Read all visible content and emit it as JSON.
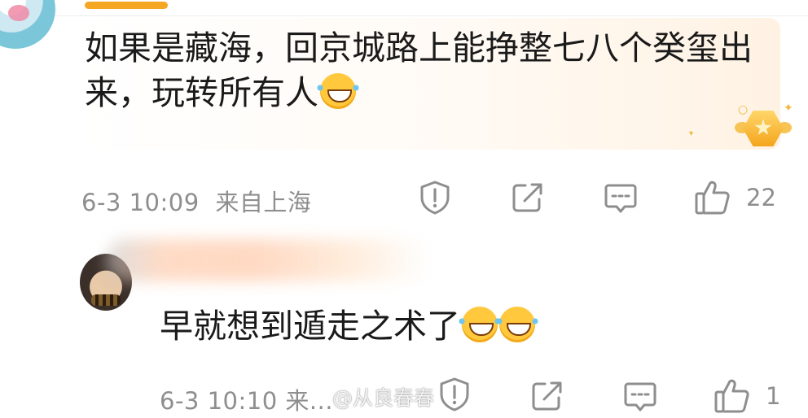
{
  "comments": [
    {
      "text": "如果是藏海，回京城路上能挣整七八个癸玺出来，玩转所有人",
      "emoji_count": 1,
      "emoji": "laugh-cry-emoji",
      "time": "6-3 10:09",
      "location": "来自上海",
      "likes": "22"
    },
    {
      "text": "早就想到遁走之术了",
      "emoji_count": 2,
      "emoji": "laugh-cry-emoji",
      "time_and_location": "6-3 10:10  来...",
      "likes": "1"
    }
  ],
  "watermark": "@从良春春",
  "actions": [
    "report-icon",
    "share-icon",
    "comment-icon",
    "like-icon"
  ],
  "colors": {
    "accent": "#f5a623",
    "meta_text": "#8e8e8e",
    "text": "#1a1a1a"
  }
}
